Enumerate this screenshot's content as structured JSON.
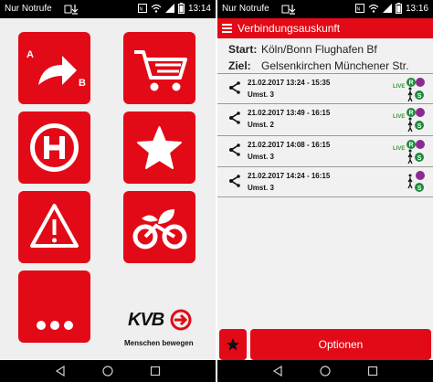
{
  "left": {
    "status": {
      "carrier": "Nur Notrufe",
      "time": "13:14"
    },
    "logo": {
      "text": "KVB",
      "slogan": "Menschen bewegen"
    },
    "tiles": {
      "route_from": "A",
      "route_to": "B"
    }
  },
  "right": {
    "status": {
      "carrier": "Nur Notrufe",
      "time": "13:16"
    },
    "toolbar": {
      "title": "Verbindungsauskunft"
    },
    "route": {
      "start_label": "Start:",
      "start_value": "Köln/Bonn Flughafen Bf",
      "ziel_label": "Ziel:",
      "ziel_value": "Gelsenkirchen Münchener Str."
    },
    "connections": [
      {
        "datetime": "21.02.2017 13:24 - 15:35",
        "transfers": "Umst. 3",
        "live": "LIVE"
      },
      {
        "datetime": "21.02.2017 13:49 - 16:15",
        "transfers": "Umst. 2",
        "live": "LIVE"
      },
      {
        "datetime": "21.02.2017 14:08 - 16:15",
        "transfers": "Umst. 3",
        "live": "LIVE"
      },
      {
        "datetime": "21.02.2017 14:24 - 16:15",
        "transfers": "Umst. 3",
        "live": ""
      }
    ],
    "options_label": "Optionen"
  },
  "colors": {
    "accent": "#e20a16",
    "live": "#2da12d",
    "sbahn": "#1d8a3c",
    "ubahn": "#8a2b8f"
  }
}
